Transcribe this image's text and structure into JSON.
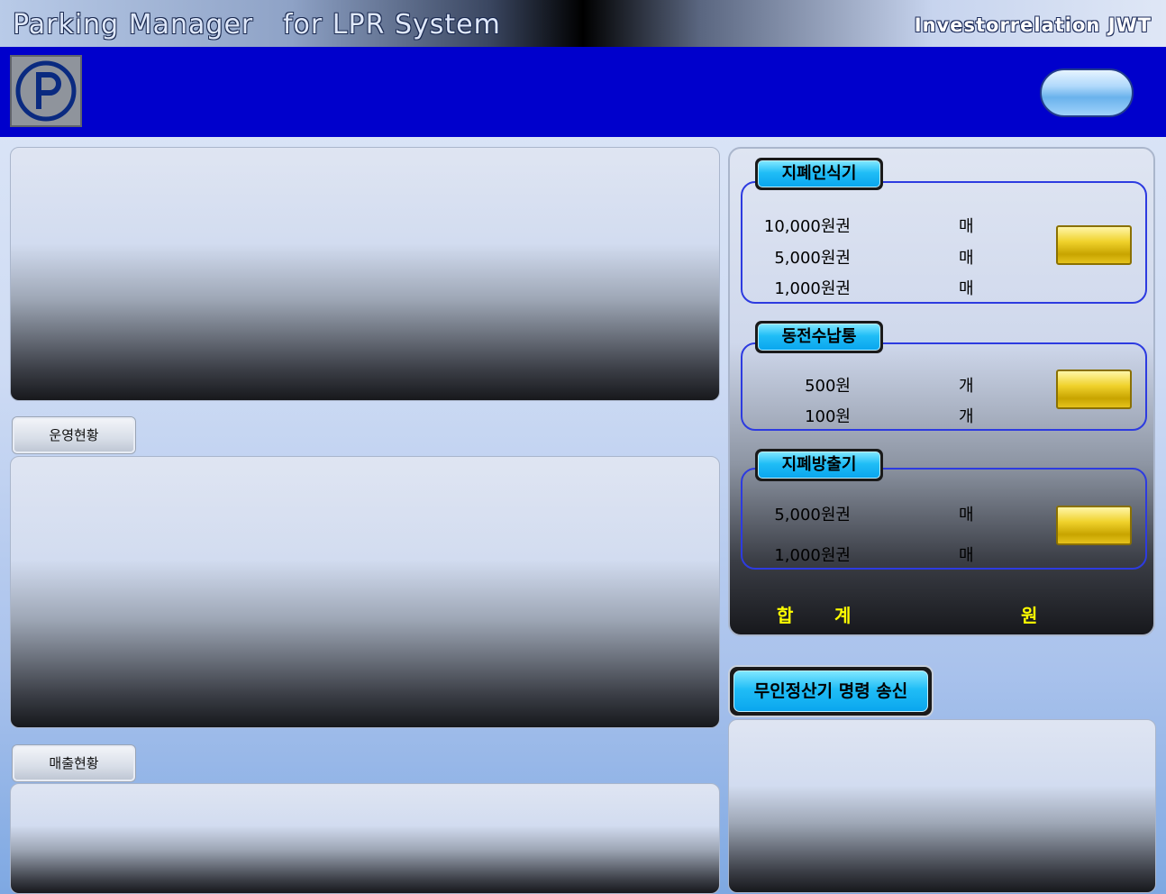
{
  "header": {
    "title_part1": "Parking Manager",
    "title_part2": "for LPR System",
    "brand": "Investorrelation JWT"
  },
  "logo": {
    "letter": "P",
    "color": "#0a2a80"
  },
  "tabs": {
    "operation_status": "운영현황",
    "sales_status": "매출현황"
  },
  "bill_acceptor": {
    "title": "지폐인식기",
    "rows": [
      {
        "label": "10,000원권",
        "unit": "매"
      },
      {
        "label": "5,000원권",
        "unit": "매"
      },
      {
        "label": "1,000원권",
        "unit": "매"
      }
    ]
  },
  "coin_box": {
    "title": "동전수납통",
    "rows": [
      {
        "label": "500원",
        "unit": "개"
      },
      {
        "label": "100원",
        "unit": "개"
      }
    ]
  },
  "bill_dispenser": {
    "title": "지폐방출기",
    "rows": [
      {
        "label": "5,000원권",
        "unit": "매"
      },
      {
        "label": "1,000원권",
        "unit": "매"
      }
    ]
  },
  "total": {
    "label_1": "합",
    "label_2": "계",
    "unit": "원"
  },
  "command_button": "무인정산기 명령 송신",
  "colors": {
    "blue_bar": "#0000cc",
    "accent_cyan": "#0aa6ee",
    "gold": "#f0d22c",
    "total_text": "#ffff00"
  }
}
